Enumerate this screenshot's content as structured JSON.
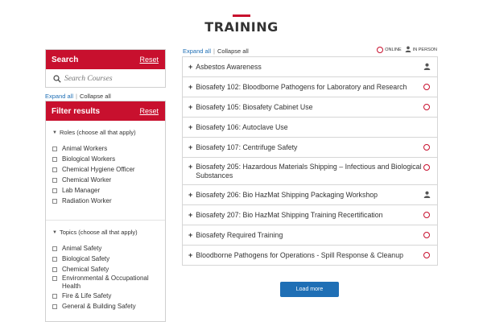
{
  "page": {
    "title": "TRAINING"
  },
  "search": {
    "title": "Search",
    "reset_label": "Reset",
    "placeholder": "Search Courses"
  },
  "sidebar_toggle": {
    "expand_label": "Expand all",
    "separator": "|",
    "collapse_label": "Collapse all"
  },
  "filters": {
    "title": "Filter results",
    "reset_label": "Reset",
    "roles": {
      "title": "Roles (choose all that apply)",
      "options": [
        "Animal Workers",
        "Biological Workers",
        "Chemical Hygiene Officer",
        "Chemical Worker",
        "Lab Manager",
        "Radiation Worker"
      ]
    },
    "topics": {
      "title": "Topics (choose all that apply)",
      "options": [
        "Animal Safety",
        "Biological Safety",
        "Chemical Safety",
        "Environmental & Occupational Health",
        "Fire & Life Safety",
        "General & Building Safety"
      ]
    }
  },
  "list_toggle": {
    "expand_label": "Expand all",
    "separator": "|",
    "collapse_label": "Collapse all"
  },
  "legend": {
    "online_label": "ONLINE",
    "in_person_label": "IN PERSON"
  },
  "courses": [
    {
      "title": "Asbestos Awareness",
      "delivery": "in-person"
    },
    {
      "title": "Biosafety 102: Bloodborne Pathogens for Laboratory and Research",
      "delivery": "online"
    },
    {
      "title": "Biosafety 105: Biosafety Cabinet Use",
      "delivery": "online"
    },
    {
      "title": "Biosafety 106: Autoclave Use",
      "delivery": ""
    },
    {
      "title": "Biosafety 107: Centrifuge Safety",
      "delivery": "online"
    },
    {
      "title": "Biosafety 205: Hazardous Materials Shipping – Infectious and Biological Substances",
      "delivery": "online"
    },
    {
      "title": "Biosafety 206: Bio HazMat Shipping Packaging Workshop",
      "delivery": "in-person"
    },
    {
      "title": "Biosafety 207: Bio HazMat Shipping Training Recertification",
      "delivery": "online"
    },
    {
      "title": "Biosafety Required Training",
      "delivery": "online"
    },
    {
      "title": "Bloodborne Pathogens for Operations - Spill Response & Cleanup",
      "delivery": "online"
    }
  ],
  "load_more_label": "Load more",
  "colors": {
    "accent_red": "#c8102e",
    "button_blue": "#1f6fb5"
  }
}
